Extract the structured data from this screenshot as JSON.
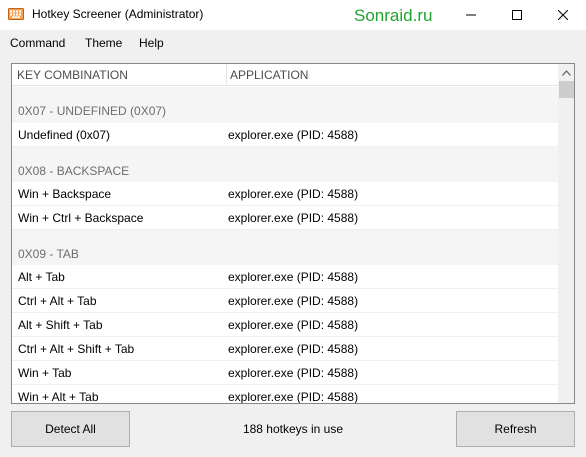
{
  "window": {
    "title": "Hotkey Screener (Administrator)",
    "watermark": "Sonraid.ru"
  },
  "menu": [
    "Command",
    "Theme",
    "Help"
  ],
  "list": {
    "columns": [
      "KEY COMBINATION",
      "APPLICATION"
    ],
    "groups": [
      {
        "label": "0X07 - UNDEFINED (0X07)",
        "rows": [
          {
            "key": "Undefined (0x07)",
            "app": "explorer.exe (PID: 4588)"
          }
        ]
      },
      {
        "label": "0X08 - BACKSPACE",
        "rows": [
          {
            "key": "Win + Backspace",
            "app": "explorer.exe (PID: 4588)"
          },
          {
            "key": "Win + Ctrl + Backspace",
            "app": "explorer.exe (PID: 4588)"
          }
        ]
      },
      {
        "label": "0X09 - TAB",
        "rows": [
          {
            "key": "Alt + Tab",
            "app": "explorer.exe (PID: 4588)"
          },
          {
            "key": "Ctrl + Alt + Tab",
            "app": "explorer.exe (PID: 4588)"
          },
          {
            "key": "Alt + Shift + Tab",
            "app": "explorer.exe (PID: 4588)"
          },
          {
            "key": "Ctrl + Alt + Shift + Tab",
            "app": "explorer.exe (PID: 4588)"
          },
          {
            "key": "Win + Tab",
            "app": "explorer.exe (PID: 4588)"
          },
          {
            "key": "Win + Alt + Tab",
            "app": "explorer.exe (PID: 4588)"
          }
        ]
      }
    ]
  },
  "footer": {
    "detect_label": "Detect All",
    "status": "188 hotkeys in use",
    "refresh_label": "Refresh"
  },
  "colors": {
    "watermark": "#1fa330",
    "group_text": "#6d6d6d",
    "border": "#828790"
  }
}
